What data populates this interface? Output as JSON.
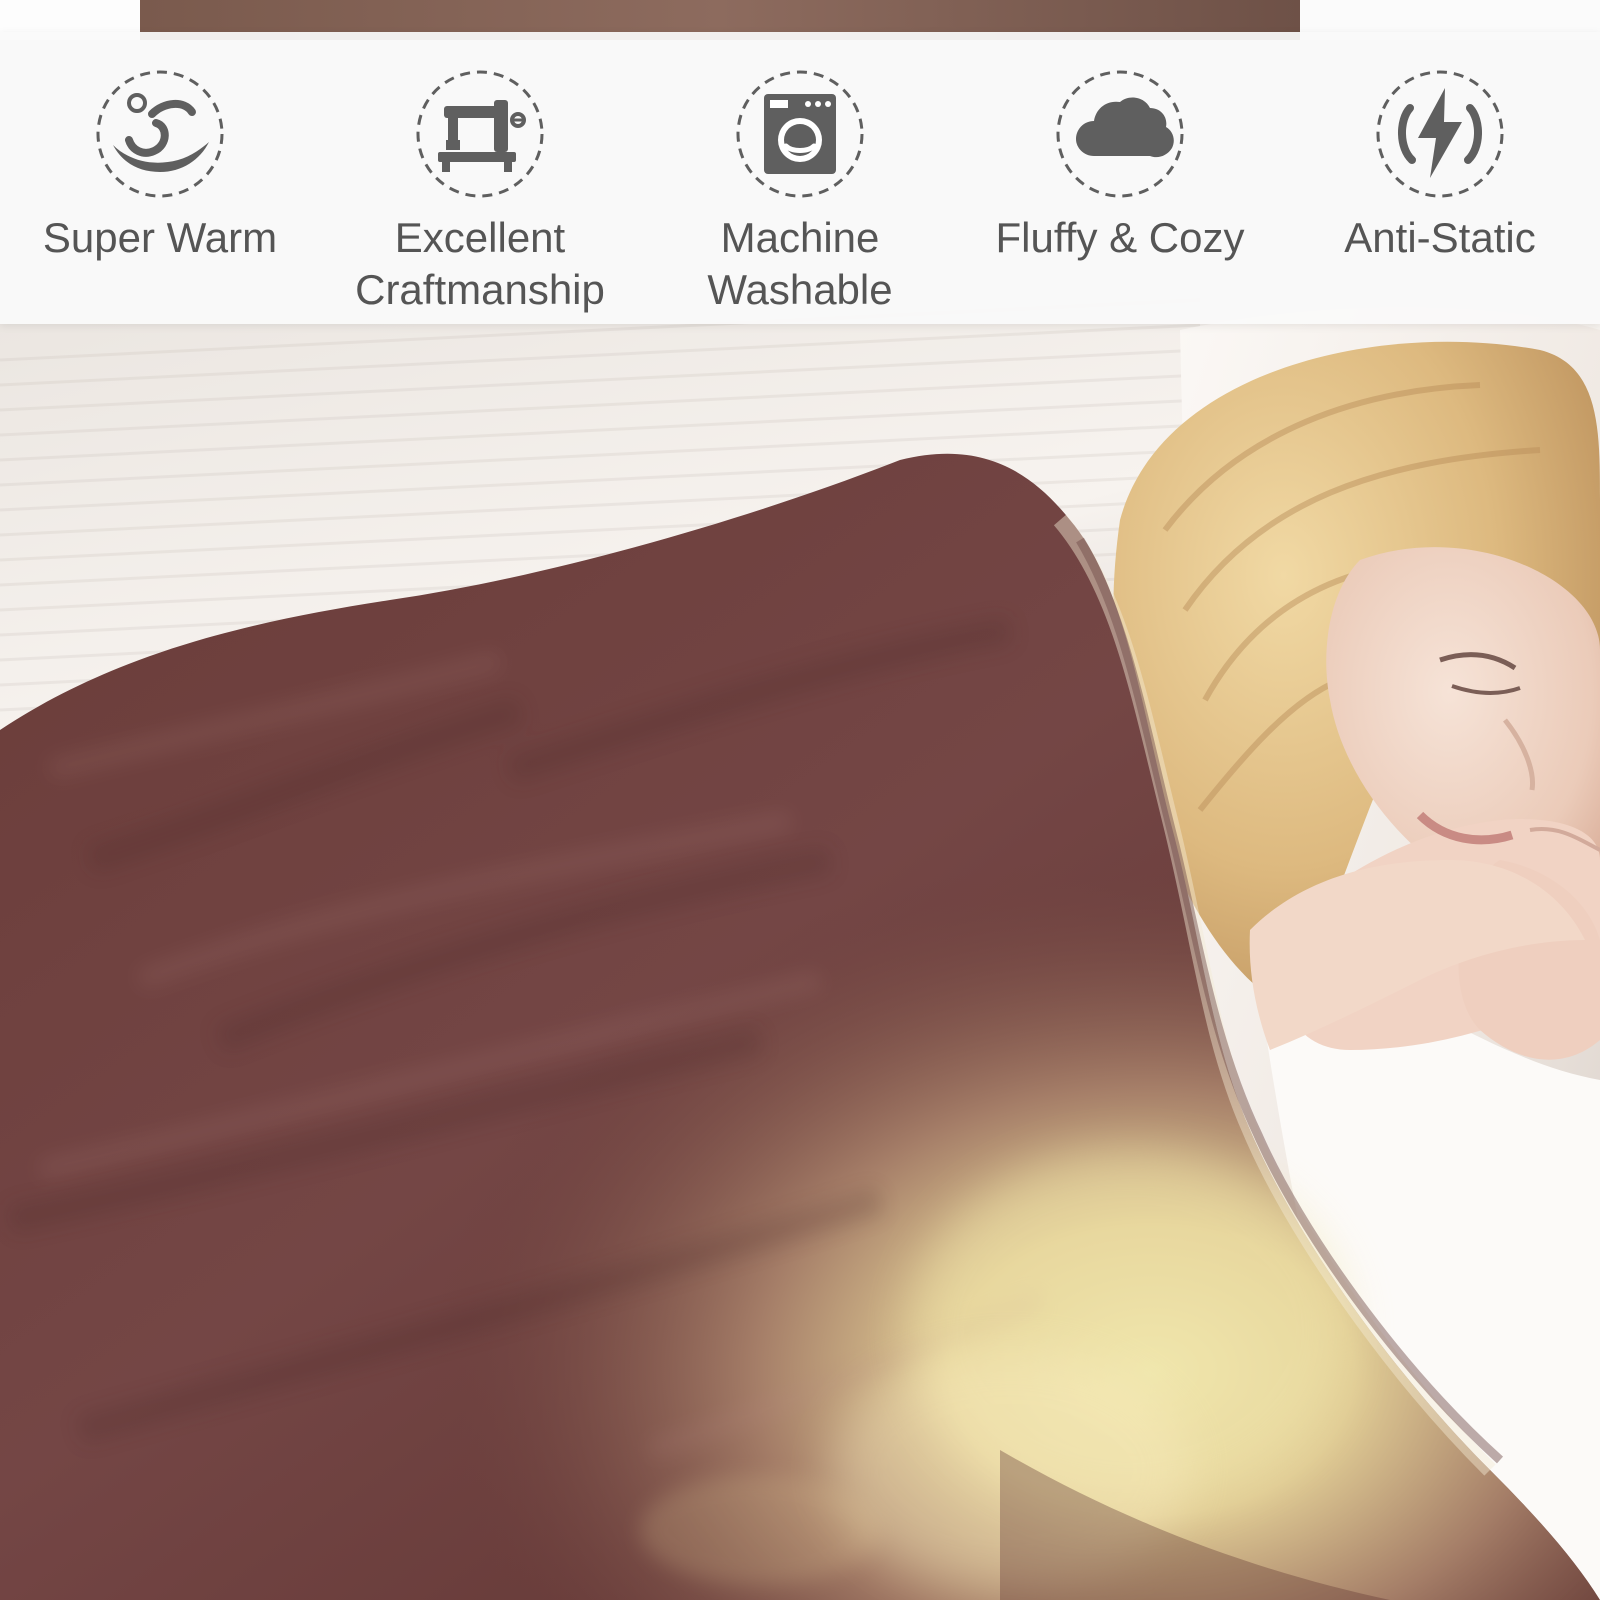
{
  "features": [
    {
      "label": "Super Warm",
      "icon": "warm-water-icon"
    },
    {
      "label": "Excellent\nCraftmanship",
      "icon": "sewing-machine-icon"
    },
    {
      "label": "Machine\nWashable",
      "icon": "washing-machine-icon"
    },
    {
      "label": "Fluffy & Cozy",
      "icon": "cloud-icon"
    },
    {
      "label": "Anti-Static",
      "icon": "lightning-bolt-icon"
    }
  ],
  "colors": {
    "banner_background": "#fafafa",
    "icon_gray": "#5f5f5f",
    "text_gray": "#555555",
    "blanket": "#6b3e3b"
  }
}
